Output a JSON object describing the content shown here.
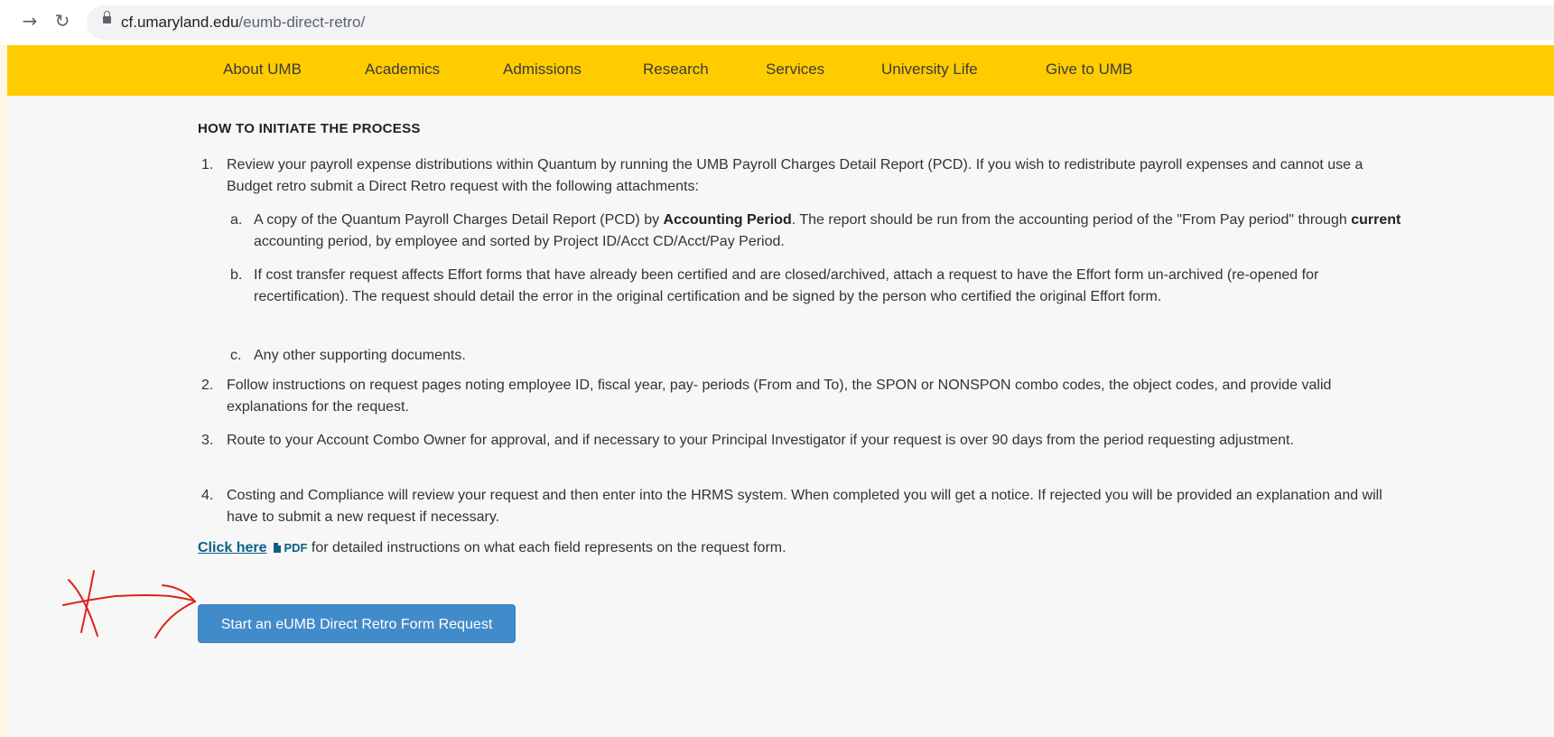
{
  "browser": {
    "url_domain": "cf.umaryland.edu",
    "url_path": "/eumb-direct-retro/"
  },
  "topnav": {
    "items": [
      "About UMB",
      "Academics",
      "Admissions",
      "Research",
      "Services",
      "University Life",
      "Give to UMB"
    ]
  },
  "main": {
    "section_title": "HOW TO INITIATE THE PROCESS",
    "steps": [
      {
        "num": "1.",
        "text": "Review your payroll expense distributions within Quantum by running the UMB Payroll Charges Detail Report (PCD). If you wish to redistribute payroll expenses and cannot use a Budget retro submit a Direct Retro request with the following attachments:",
        "substeps": [
          {
            "letter": "a.",
            "t1": "A copy of the Quantum Payroll Charges Detail Report (PCD) by ",
            "b1": "Accounting Period",
            "t2": ". The report should be run from the accounting period of the \"From Pay period\" through ",
            "b2": "current",
            "t3": " accounting period, by employee and sorted by Project ID/Acct CD/Acct/Pay Period."
          },
          {
            "letter": "b.",
            "text": "If cost transfer request affects Effort forms that have already been certified and are closed/archived, attach a request to have the Effort form un-archived (re-opened for recertification). The request should detail the error in the original certification and be signed by the person who certified the original Effort form."
          },
          {
            "letter": "c.",
            "text": "Any other supporting documents."
          }
        ]
      },
      {
        "num": "2.",
        "text": "Follow instructions on request pages noting employee ID, fiscal year, pay- periods (From and To), the SPON or NONSPON combo codes, the object codes, and provide valid explanations for the request."
      },
      {
        "num": "3.",
        "text": "Route to your Account Combo Owner for approval, and if necessary to your Principal Investigator if your request is over 90 days from the period requesting adjustment."
      },
      {
        "num": "4.",
        "text": "Costing and Compliance will review your request and then enter into the HRMS system. When completed you will get a notice. If rejected you will be provided an explanation and will have to submit a new request if necessary."
      }
    ],
    "click_here": {
      "link": "Click here",
      "pdf_label": "PDF",
      "rest": " for detailed instructions on what each field represents on the request form."
    },
    "start_button": "Start an eUMB Direct Retro Form Request"
  },
  "colors": {
    "nav_bar": "#ffcc00",
    "link": "#0b5f86",
    "button": "#428bca",
    "annotation": "#e0201b"
  }
}
